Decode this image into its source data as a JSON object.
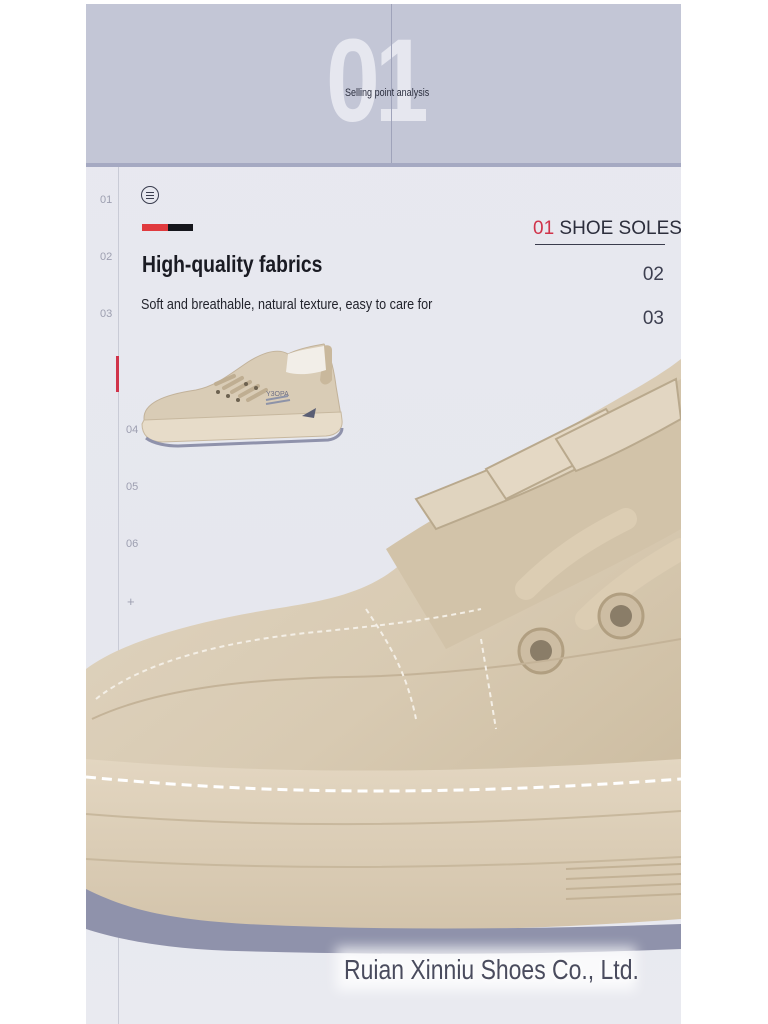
{
  "header": {
    "big_number": "01",
    "subtitle": "Selling point analysis"
  },
  "rail": {
    "items": [
      "01",
      "02",
      "03",
      "04",
      "05",
      "06"
    ],
    "plus": "+"
  },
  "feature": {
    "title": "High-quality fabrics",
    "description": "Soft and breathable, natural texture, easy to care for"
  },
  "tabs": {
    "active": {
      "number": "01",
      "label": "SHOE SOLES"
    },
    "items": [
      "02",
      "03"
    ]
  },
  "footer": {
    "company": "Ruian Xinniu Shoes Co., Ltd."
  },
  "colors": {
    "header_bg": "#c3c6d6",
    "page_bg": "#e8e9f0",
    "accent_red": "#e03a3e",
    "accent_black": "#15161c",
    "active_tab_number": "#d0334a",
    "shoe_beige": "#dcd0bc"
  },
  "icons": [
    "menu-icon"
  ]
}
